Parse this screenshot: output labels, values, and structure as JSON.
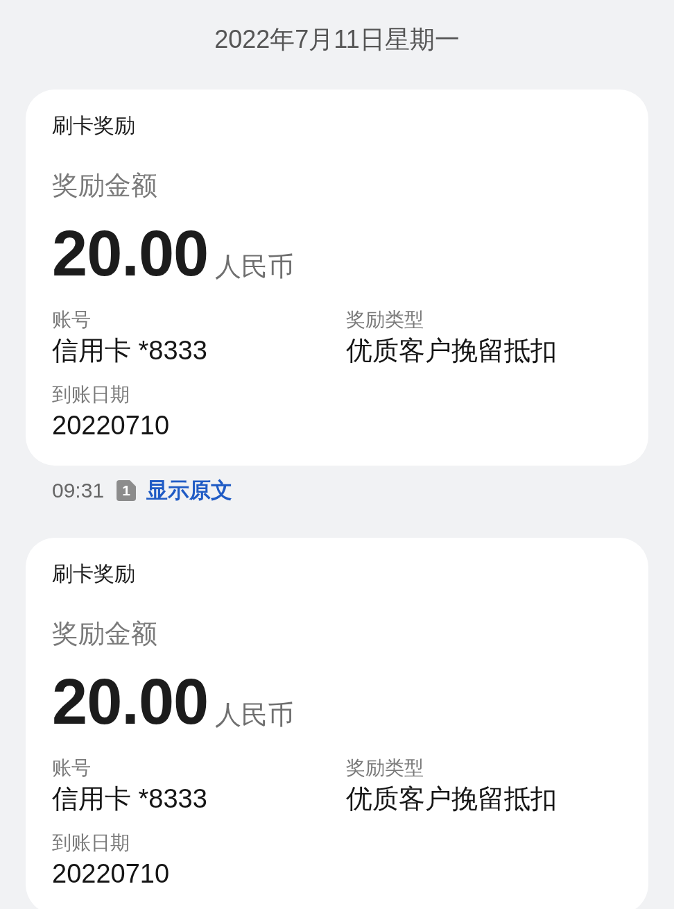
{
  "date_header": "2022年7月11日星期一",
  "messages": [
    {
      "title": "刷卡奖励",
      "amount_label": "奖励金额",
      "amount": "20.00",
      "currency": "人民币",
      "fields": [
        {
          "label": "账号",
          "value": "信用卡 *8333"
        },
        {
          "label": "奖励类型",
          "value": "优质客户挽留抵扣"
        },
        {
          "label": "到账日期",
          "value": "20220710"
        }
      ],
      "time": "09:31",
      "sim": "1",
      "link": "显示原文"
    },
    {
      "title": "刷卡奖励",
      "amount_label": "奖励金额",
      "amount": "20.00",
      "currency": "人民币",
      "fields": [
        {
          "label": "账号",
          "value": "信用卡 *8333"
        },
        {
          "label": "奖励类型",
          "value": "优质客户挽留抵扣"
        },
        {
          "label": "到账日期",
          "value": "20220710"
        }
      ]
    }
  ]
}
